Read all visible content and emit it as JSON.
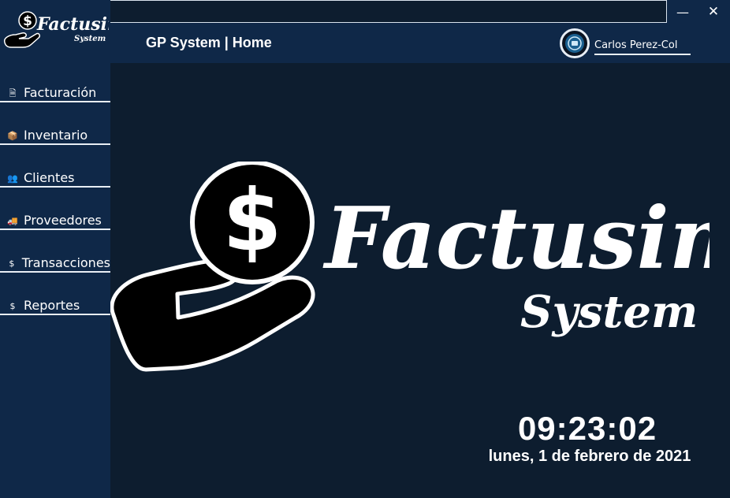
{
  "window": {
    "minimize_glyph": "—",
    "close_glyph": "✕"
  },
  "brand": {
    "name": "Factusin",
    "sub": "System",
    "currency_glyph": "$"
  },
  "header": {
    "title": "GP System | Home",
    "user": {
      "name": "Carlos Perez-Col",
      "avatar_icon": "user-avatar-icon"
    }
  },
  "sidebar": {
    "items": [
      {
        "label": "Facturación",
        "icon": "document-icon",
        "glyph": "🗎"
      },
      {
        "label": "Inventario",
        "icon": "box-icon",
        "glyph": "📦"
      },
      {
        "label": "Clientes",
        "icon": "users-icon",
        "glyph": "👥"
      },
      {
        "label": "Proveedores",
        "icon": "truck-icon",
        "glyph": "🚚"
      },
      {
        "label": "Transacciones",
        "icon": "dollar-icon",
        "glyph": "$"
      },
      {
        "label": "Reportes",
        "icon": "dollar-icon",
        "glyph": "$"
      }
    ]
  },
  "main": {
    "time": "09:23:02",
    "date": "lunes, 1 de febrero de 2021"
  },
  "colors": {
    "sidebar_bg": "#0f2848",
    "main_bg": "#0d1d2f",
    "accent": "#ffffff"
  }
}
